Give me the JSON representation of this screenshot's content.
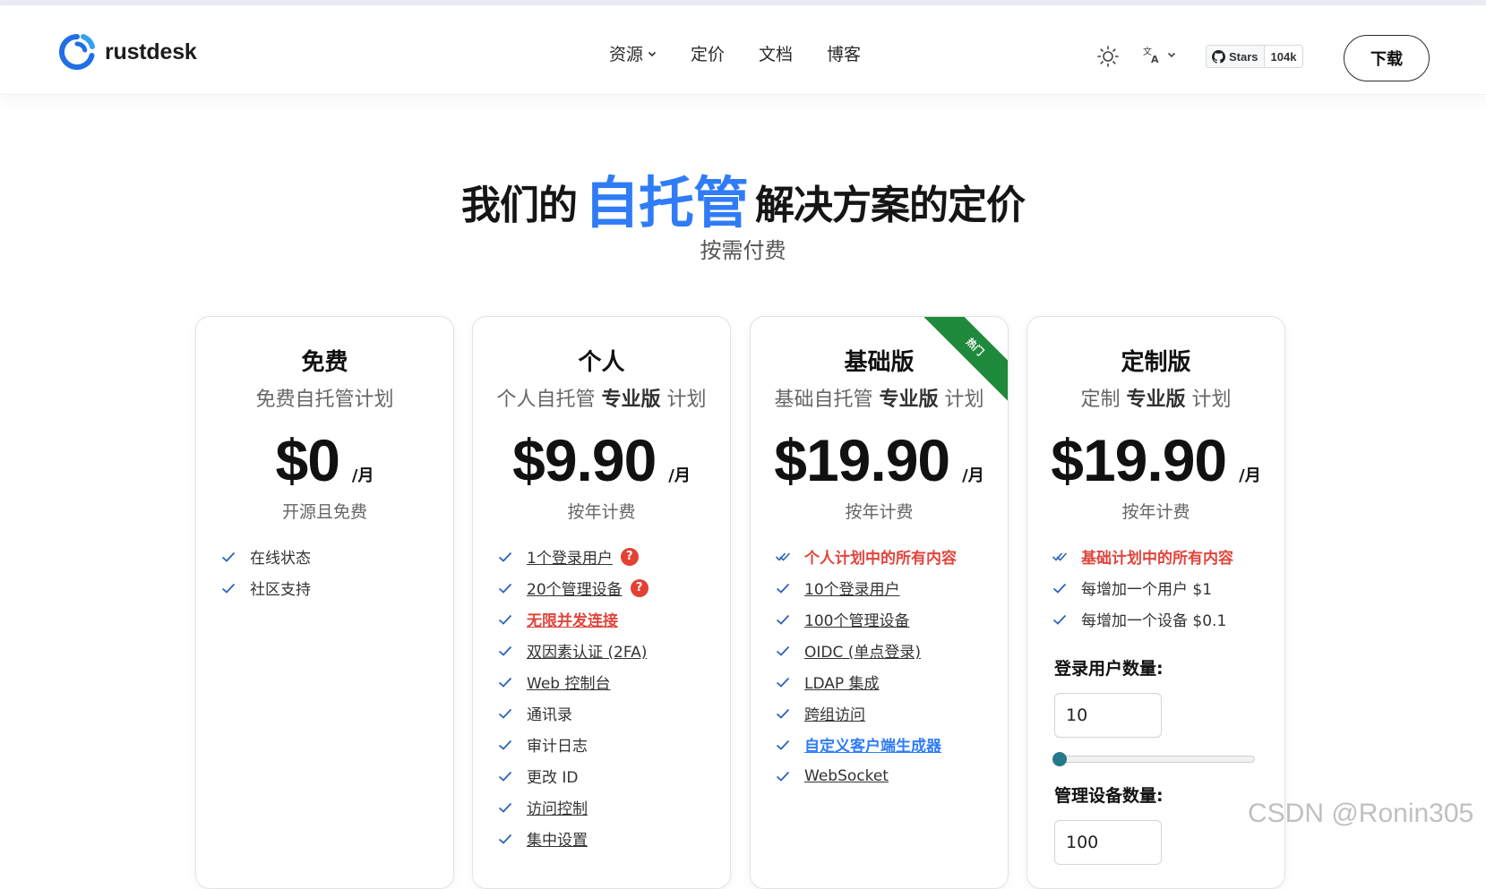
{
  "brand": {
    "name": "rustdesk",
    "accent": "#2f7cf6"
  },
  "nav": {
    "items": [
      {
        "label": "资源",
        "dropdown": true
      },
      {
        "label": "定价"
      },
      {
        "label": "文档"
      },
      {
        "label": "博客"
      }
    ],
    "github": {
      "label": "Stars",
      "count": "104k"
    },
    "download_label": "下载"
  },
  "hero": {
    "title_before": "我们的",
    "title_highlight": "自托管",
    "title_after": "解决方案的定价",
    "subtitle": "按需付费"
  },
  "plans": [
    {
      "title": "免费",
      "subtitle": "免费自托管计划",
      "price": "$0",
      "period": "/月",
      "billing": "开源且免费",
      "features": [
        {
          "text": "在线状态"
        },
        {
          "text": "社区支持"
        }
      ]
    },
    {
      "title": "个人",
      "subtitle_prefix": "个人自托管",
      "subtitle_bold": "专业版",
      "subtitle_suffix": "计划",
      "price": "$9.90",
      "period": "/月",
      "billing": "按年计费",
      "features": [
        {
          "text": "1个登录用户",
          "style": "link",
          "help": "?"
        },
        {
          "text": "20个管理设备",
          "style": "link",
          "help": "?"
        },
        {
          "text": "无限并发连接",
          "style": "red-link"
        },
        {
          "text": "双因素认证 (2FA)",
          "style": "link"
        },
        {
          "text": "Web 控制台",
          "style": "link"
        },
        {
          "text": "通讯录"
        },
        {
          "text": "审计日志"
        },
        {
          "text": "更改 ID"
        },
        {
          "text": "访问控制",
          "style": "link"
        },
        {
          "text": "集中设置",
          "style": "link"
        }
      ]
    },
    {
      "title": "基础版",
      "subtitle_prefix": "基础自托管",
      "subtitle_bold": "专业版",
      "subtitle_suffix": "计划",
      "price": "$19.90",
      "period": "/月",
      "billing": "按年计费",
      "ribbon": "热门",
      "features": [
        {
          "text": "个人计划中的所有内容",
          "style": "red",
          "double": true
        },
        {
          "text": "10个登录用户",
          "style": "link"
        },
        {
          "text": "100个管理设备",
          "style": "link"
        },
        {
          "text": "OIDC (单点登录)",
          "style": "link"
        },
        {
          "text": "LDAP 集成",
          "style": "link"
        },
        {
          "text": "跨组访问",
          "style": "link"
        },
        {
          "text": "自定义客户端生成器",
          "style": "blue"
        },
        {
          "text": "WebSocket",
          "style": "link"
        }
      ]
    },
    {
      "title": "定制版",
      "subtitle_prefix": "定制",
      "subtitle_bold": "专业版",
      "subtitle_suffix": "计划",
      "price": "$19.90",
      "period": "/月",
      "billing": "按年计费",
      "features": [
        {
          "text": "基础计划中的所有内容",
          "style": "red",
          "double": true
        },
        {
          "text": "每增加一个用户 $1"
        },
        {
          "text": "每增加一个设备 $0.1"
        }
      ],
      "users_label": "登录用户数量:",
      "users_value": "10",
      "users_slider": 0.0,
      "devices_label": "管理设备数量:",
      "devices_value": "100"
    }
  ],
  "watermark": "CSDN @Ronin305"
}
